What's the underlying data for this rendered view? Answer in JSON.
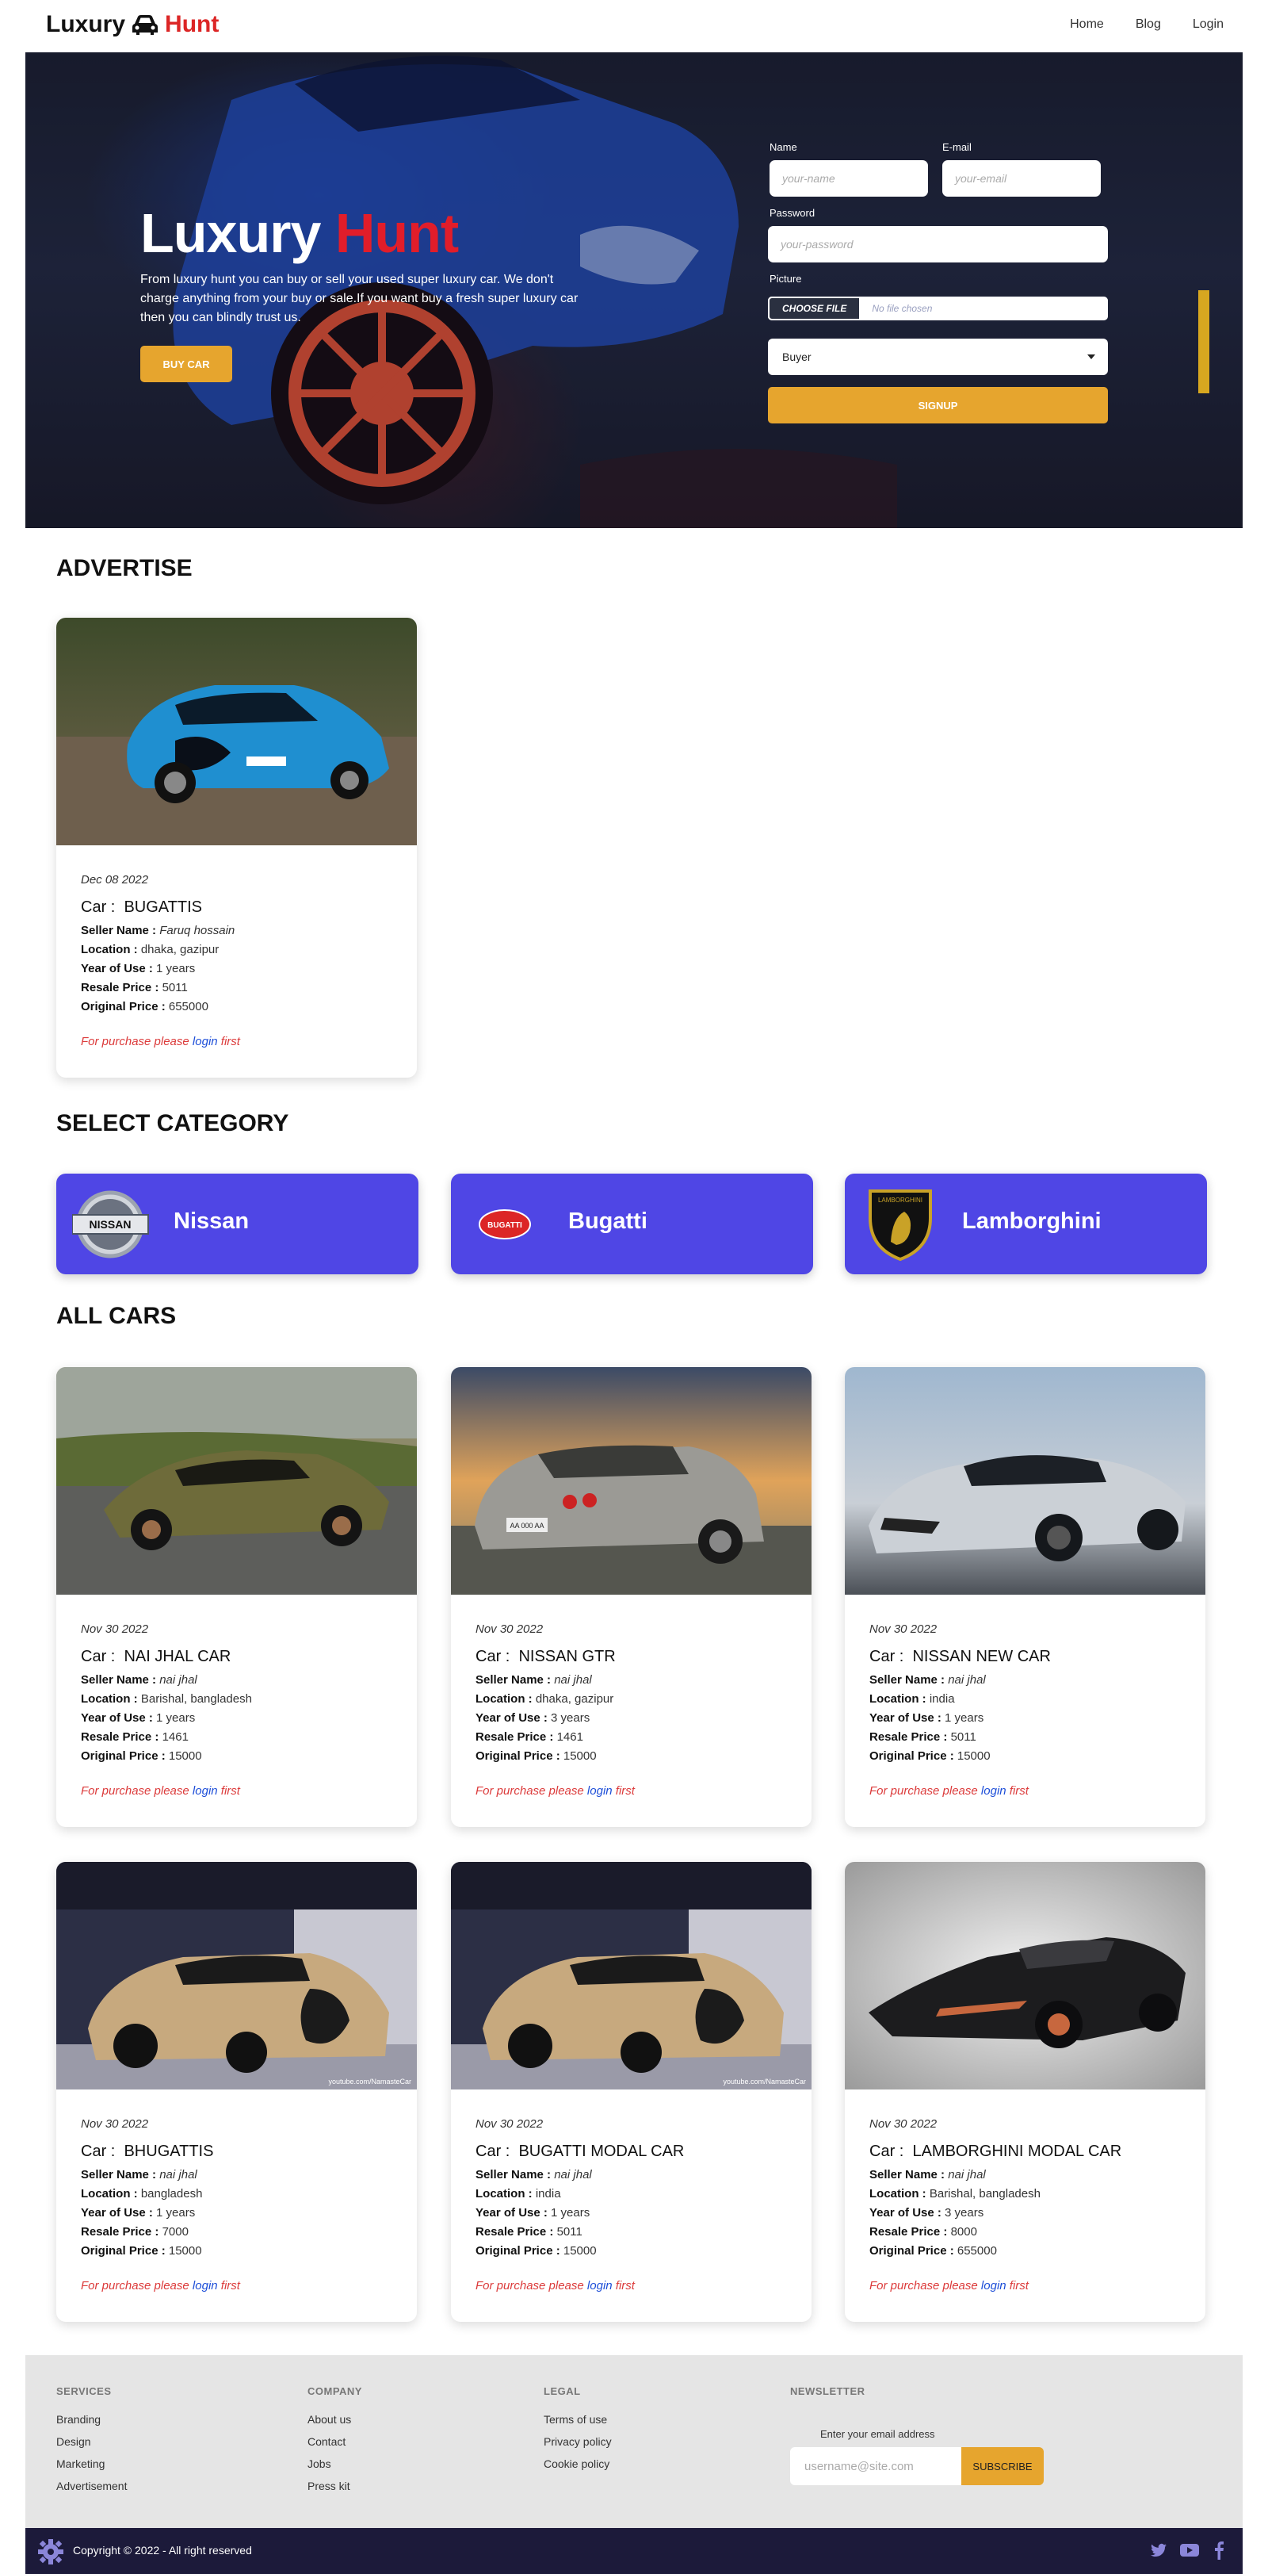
{
  "nav": {
    "brand_a": "Luxury",
    "brand_b": "Hunt",
    "links": [
      "Home",
      "Blog",
      "Login"
    ]
  },
  "hero": {
    "title_a": "Luxury",
    "title_b": "Hunt",
    "description": "From luxury hunt you can buy or sell your used super luxury car. We don't charge anything from your buy or sale.If you want buy a fresh super luxury car then you can blindly trust us.",
    "buy_button": "BUY CAR",
    "form": {
      "name_label": "Name",
      "name_placeholder": "your-name",
      "email_label": "E-mail",
      "email_placeholder": "your-email",
      "password_label": "Password",
      "password_placeholder": "your-password",
      "picture_label": "Picture",
      "choose_file": "CHOOSE FILE",
      "no_file": "No file chosen",
      "role_selected": "Buyer",
      "signup_button": "SIGNUP"
    }
  },
  "labels": {
    "car": "Car :",
    "seller": "Seller Name :",
    "location": "Location :",
    "year": "Year of Use :",
    "resale": "Resale Price :",
    "original": "Original Price :",
    "buy_prefix": "For purchase please ",
    "buy_link": "login",
    "buy_suffix": " first"
  },
  "advertise": {
    "title": "ADVERTISE",
    "card": {
      "date": "Dec 08 2022",
      "name": "BUGATTIS",
      "seller": "Faruq hossain",
      "location": "dhaka, gazipur",
      "year": "1 years",
      "resale": "5011",
      "original": "655000"
    }
  },
  "categories": {
    "title": "SELECT CATEGORY",
    "items": [
      "Nissan",
      "Bugatti",
      "Lamborghini"
    ],
    "badge_nissan": "NISSAN",
    "badge_bugatti": "BUGATTI",
    "badge_lambo": "LAMBORGHINI"
  },
  "all_cars": {
    "title": "ALL CARS",
    "watermark": "youtube.com/NamasteCar",
    "cards": [
      {
        "date": "Nov 30 2022",
        "name": "NAI JHAL CAR",
        "seller": "nai jhal",
        "location": "Barishal, bangladesh",
        "year": "1 years",
        "resale": "1461",
        "original": "15000"
      },
      {
        "date": "Nov 30 2022",
        "name": "NISSAN GTR",
        "seller": "nai jhal",
        "location": "dhaka, gazipur",
        "year": "3 years",
        "resale": "1461",
        "original": "15000",
        "plate": "AA 000 AA"
      },
      {
        "date": "Nov 30 2022",
        "name": "NISSAN NEW CAR",
        "seller": "nai jhal",
        "location": "india",
        "year": "1 years",
        "resale": "5011",
        "original": "15000"
      },
      {
        "date": "Nov 30 2022",
        "name": "BHUGATTIS",
        "seller": "nai jhal",
        "location": "bangladesh",
        "year": "1 years",
        "resale": "7000",
        "original": "15000"
      },
      {
        "date": "Nov 30 2022",
        "name": "BUGATTI MODAL CAR",
        "seller": "nai jhal",
        "location": "india",
        "year": "1 years",
        "resale": "5011",
        "original": "15000"
      },
      {
        "date": "Nov 30 2022",
        "name": "LAMBORGHINI MODAL CAR",
        "seller": "nai jhal",
        "location": "Barishal, bangladesh",
        "year": "3 years",
        "resale": "8000",
        "original": "655000"
      }
    ]
  },
  "footer": {
    "services": {
      "head": "SERVICES",
      "links": [
        "Branding",
        "Design",
        "Marketing",
        "Advertisement"
      ]
    },
    "company": {
      "head": "COMPANY",
      "links": [
        "About us",
        "Contact",
        "Jobs",
        "Press kit"
      ]
    },
    "legal": {
      "head": "LEGAL",
      "links": [
        "Terms of use",
        "Privacy policy",
        "Cookie policy"
      ]
    },
    "newsletter": {
      "head": "NEWSLETTER",
      "label": "Enter your email address",
      "placeholder": "username@site.com",
      "button": "SUBSCRIBE"
    },
    "copyright": "Copyright © 2022 - All right reserved",
    "social_icons": [
      "twitter-icon",
      "youtube-icon",
      "facebook-icon"
    ]
  },
  "colors": {
    "accent": "#e6a52e",
    "brand_red": "#dc2626",
    "category_bg": "#4f46e5",
    "footer_bottom": "#1c1a3a"
  }
}
